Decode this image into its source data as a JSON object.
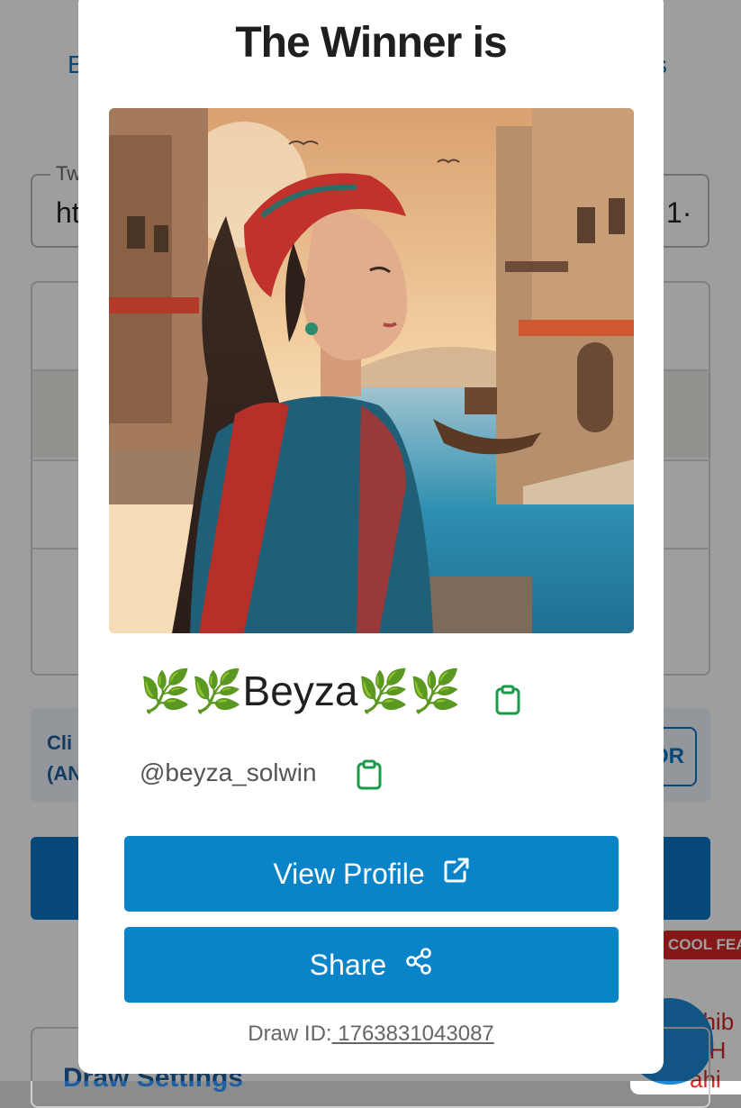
{
  "background": {
    "tab_left": "E",
    "tab_right": "s",
    "url_legend": "Tw",
    "url_text_left": "ht",
    "url_text_right": "1·",
    "info_text_line1": "Cli",
    "info_text_line2": "(AN",
    "or_button": "OR",
    "cool_badge": "COOL FEA",
    "chat_text": "ahib\nn H\nahi",
    "bottom_text": "Draw Settings"
  },
  "modal": {
    "title": "The Winner is",
    "winner": {
      "display_name": "🌿🌿Beyza🌿🌿",
      "handle": "@beyza_solwin"
    },
    "view_profile_label": "View Profile",
    "share_label": "Share",
    "draw_id_label": "Draw ID:",
    "draw_id_value": " 1763831043087"
  },
  "icons": {
    "copy_name": "clipboard-icon",
    "copy_handle": "clipboard-icon",
    "view_profile": "external-link-icon",
    "share": "share-icon"
  },
  "colors": {
    "primary_button": "#0984c8",
    "clipboard_icon": "#1a9a4a",
    "badge_red": "#d62828"
  }
}
